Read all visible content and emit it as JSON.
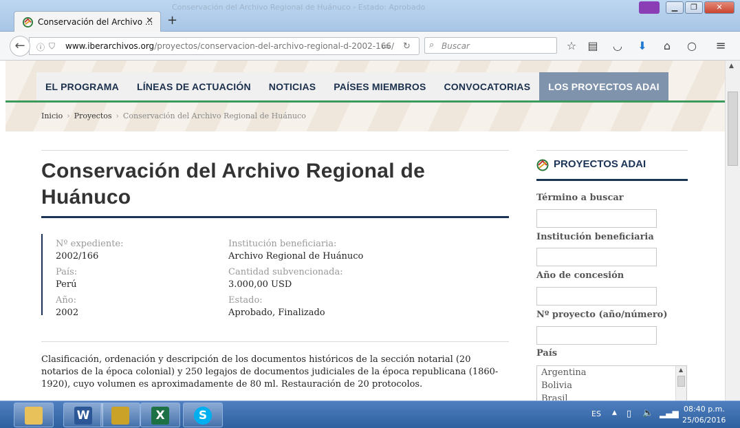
{
  "browser": {
    "tab_title": "Conservación del Archivo ...",
    "tab_close": "✕",
    "new_tab": "+",
    "ghost_title": "Conservación del Archivo Regional de Huánuco - Estado: Aprobado",
    "url_domain": "www.iberarchivos.org",
    "url_path": "/proyectos/conservacion-del-archivo-regional-d-2002-166/",
    "search_placeholder": "Buscar",
    "window_buttons": [
      "▁",
      "❐",
      "✕"
    ]
  },
  "site": {
    "menu": [
      "EL PROGRAMA",
      "LÍNEAS DE ACTUACIÓN",
      "NOTICIAS",
      "PAÍSES MIEMBROS",
      "CONVOCATORIAS",
      "LOS PROYECTOS ADAI"
    ],
    "active_menu_index": 5,
    "breadcrumb": {
      "home": "Inicio",
      "section": "Proyectos",
      "current": "Conservación del Archivo Regional de Huánuco",
      "sep": "›"
    }
  },
  "project": {
    "title": "Conservación del Archivo Regional de Huánuco",
    "expediente_label": "Nº expediente:",
    "expediente": "2002/166",
    "pais_label": "País:",
    "pais": "Perú",
    "anio_label": "Año:",
    "anio": "2002",
    "institucion_label": "Institución beneficiaria:",
    "institucion": "Archivo Regional de Huánuco",
    "cantidad_label": "Cantidad subvencionada:",
    "cantidad": "3.000,00 USD",
    "estado_label": "Estado:",
    "estado": "Aprobado, Finalizado",
    "description": "Clasificación, ordenación y descripción de los documentos históricos de la sección notarial (20 notarios de la época colonial) y 250 legajos de documentos judiciales de la época republicana (1860-1920), cuyo volumen es aproximadamente de 80 ml. Restauración de 20 protocolos."
  },
  "sidebar": {
    "title": "PROYECTOS ADAI",
    "termino_label": "Término a buscar",
    "institucion_label": "Institución beneficiaria",
    "anio_label": "Año de concesión",
    "proyecto_label": "Nº proyecto (año/número)",
    "pais_label": "País",
    "countries": [
      "Argentina",
      "Bolivia",
      "Brasil"
    ]
  },
  "taskbar": {
    "language": "ES",
    "time": "08:40 p.m.",
    "date": "25/06/2016",
    "apps": [
      "W",
      "X",
      "S"
    ]
  },
  "colors": {
    "navy": "#1c3358",
    "green": "#3a9a5b",
    "active_menu": "#7f93ad"
  }
}
